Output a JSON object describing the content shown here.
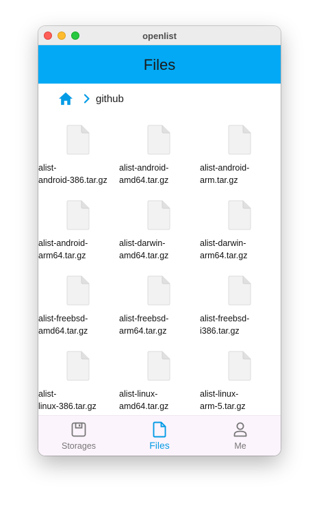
{
  "window": {
    "title": "openlist"
  },
  "appbar": {
    "title": "Files",
    "color": "#03a9f4"
  },
  "breadcrumb": {
    "home_icon": "home-icon",
    "path": "github"
  },
  "files": [
    {
      "name": "alist-\nandroid-386.tar.gz"
    },
    {
      "name": "alist-android-\namd64.tar.gz"
    },
    {
      "name": "alist-android-\narm.tar.gz"
    },
    {
      "name": "alist-android-\narm64.tar.gz"
    },
    {
      "name": "alist-darwin-\namd64.tar.gz"
    },
    {
      "name": "alist-darwin-\narm64.tar.gz"
    },
    {
      "name": "alist-freebsd-\namd64.tar.gz"
    },
    {
      "name": "alist-freebsd-\narm64.tar.gz"
    },
    {
      "name": "alist-freebsd-\ni386.tar.gz"
    },
    {
      "name": "alist-\nlinux-386.tar.gz"
    },
    {
      "name": "alist-linux-\namd64.tar.gz"
    },
    {
      "name": "alist-linux-\narm-5.tar.gz"
    }
  ],
  "nav": {
    "items": [
      {
        "label": "Storages",
        "icon": "storage-icon"
      },
      {
        "label": "Files",
        "icon": "file-icon",
        "active": true
      },
      {
        "label": "Me",
        "icon": "person-icon"
      }
    ],
    "active_color": "#039be5"
  }
}
